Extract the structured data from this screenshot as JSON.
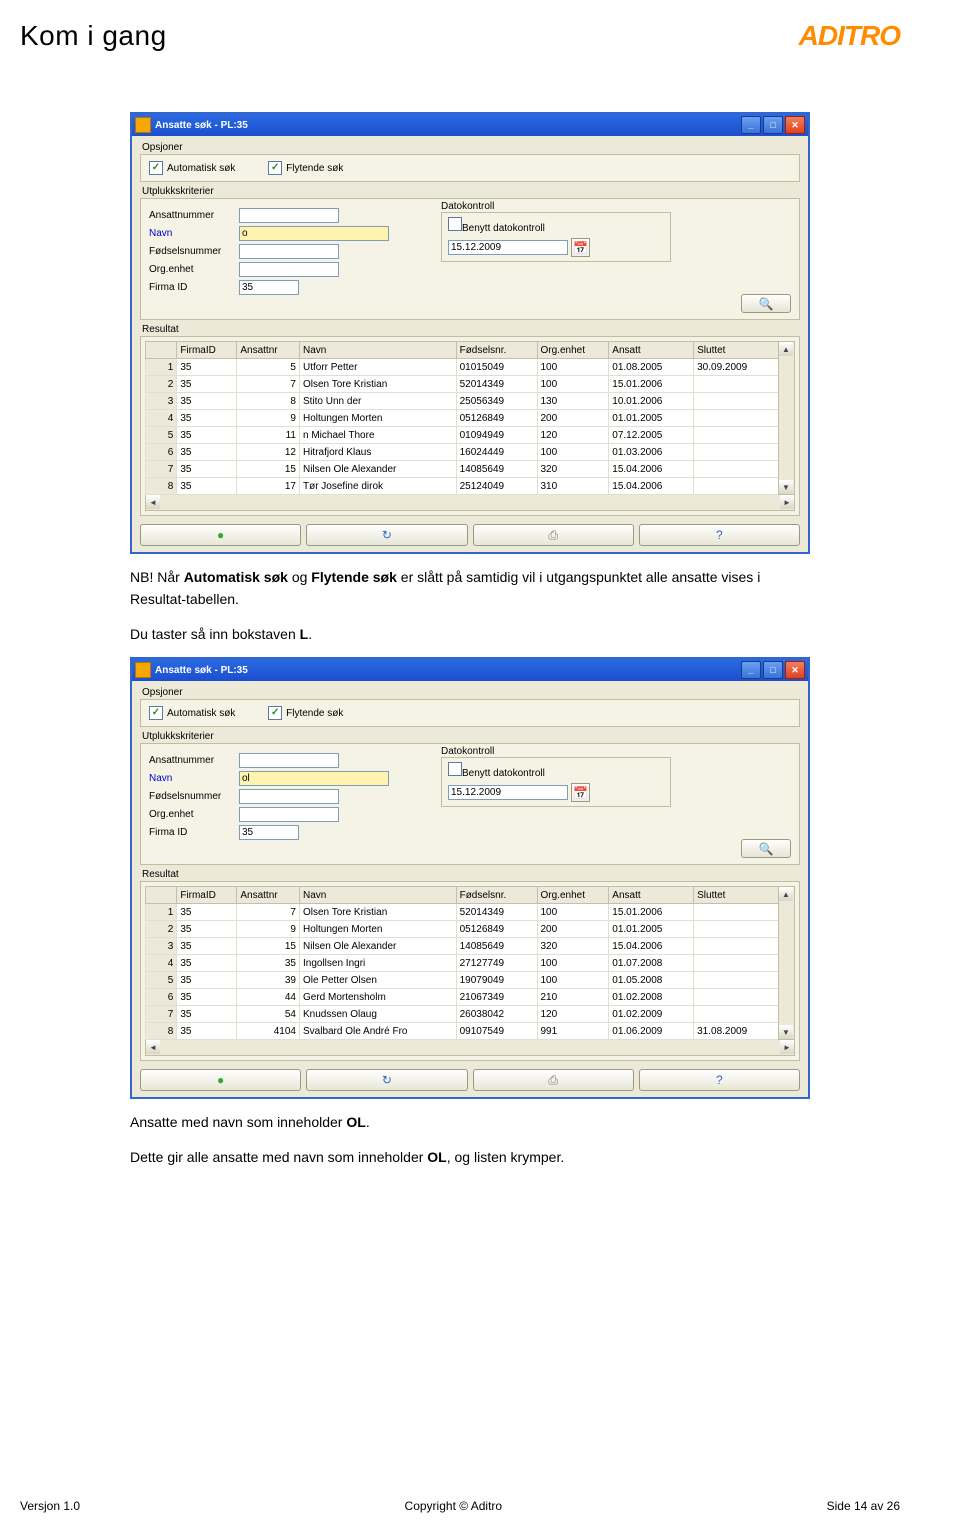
{
  "header": {
    "title": "Kom i gang",
    "logo": "ADITRO"
  },
  "text": {
    "p1_a": "NB! Når ",
    "p1_b": "Automatisk søk",
    "p1_c": " og ",
    "p1_d": "Flytende søk",
    "p1_e": " er slått på samtidig vil i utgangspunktet alle ansatte vises i Resultat-tabellen.",
    "p2_a": "Du taster så inn bokstaven ",
    "p2_b": "L",
    "p2_c": ".",
    "p3_a": "Ansatte med navn som inneholder ",
    "p3_b": "OL",
    "p3_c": ".",
    "p4_a": "Dette gir alle ansatte med navn som inneholder ",
    "p4_b": "OL",
    "p4_c": ", og listen krymper."
  },
  "win": {
    "title": "Ansatte søk - PL:35",
    "opsjoner": "Opsjoner",
    "auto": "Automatisk søk",
    "flyt": "Flytende søk",
    "utplukk": "Utplukkskriterier",
    "ansattnr": "Ansattnummer",
    "navn": "Navn",
    "fnr": "Fødselsnummer",
    "org": "Org.enhet",
    "firma": "Firma ID",
    "firma_val": "35",
    "dato": "Datokontroll",
    "benytt": "Benytt datokontroll",
    "date_val": "15.12.2009",
    "resultat": "Resultat",
    "check": "✓"
  },
  "cols": [
    "FirmaID",
    "Ansattnr",
    "Navn",
    "Fødselsnr.",
    "Org.enhet",
    "Ansatt",
    "Sluttet"
  ],
  "s1": {
    "navn_val": "o",
    "rows": [
      [
        "1",
        "35",
        "5",
        "Utforr Petter",
        "01015049",
        "100",
        "01.08.2005",
        "30.09.2009"
      ],
      [
        "2",
        "35",
        "7",
        "Olsen Tore Kristian",
        "52014349",
        "100",
        "15.01.2006",
        ""
      ],
      [
        "3",
        "35",
        "8",
        "Stito Unn der",
        "25056349",
        "130",
        "10.01.2006",
        ""
      ],
      [
        "4",
        "35",
        "9",
        "Holtungen Morten",
        "05126849",
        "200",
        "01.01.2005",
        ""
      ],
      [
        "5",
        "35",
        "11",
        "n Michael Thore",
        "01094949",
        "120",
        "07.12.2005",
        ""
      ],
      [
        "6",
        "35",
        "12",
        "Hitrafjord Klaus",
        "16024449",
        "100",
        "01.03.2006",
        ""
      ],
      [
        "7",
        "35",
        "15",
        "Nilsen Ole Alexander",
        "14085649",
        "320",
        "15.04.2006",
        ""
      ],
      [
        "8",
        "35",
        "17",
        "Tør Josefine dirok",
        "25124049",
        "310",
        "15.04.2006",
        ""
      ]
    ]
  },
  "s2": {
    "navn_val": "ol",
    "rows": [
      [
        "1",
        "35",
        "7",
        "Olsen Tore Kristian",
        "52014349",
        "100",
        "15.01.2006",
        ""
      ],
      [
        "2",
        "35",
        "9",
        "Holtungen Morten",
        "05126849",
        "200",
        "01.01.2005",
        ""
      ],
      [
        "3",
        "35",
        "15",
        "Nilsen Ole Alexander",
        "14085649",
        "320",
        "15.04.2006",
        ""
      ],
      [
        "4",
        "35",
        "35",
        "Ingollsen Ingri",
        "27127749",
        "100",
        "01.07.2008",
        ""
      ],
      [
        "5",
        "35",
        "39",
        "Ole Petter Olsen",
        "19079049",
        "100",
        "01.05.2008",
        ""
      ],
      [
        "6",
        "35",
        "44",
        "Gerd Mortensholm",
        "21067349",
        "210",
        "01.02.2008",
        ""
      ],
      [
        "7",
        "35",
        "54",
        "Knudssen Olaug",
        "26038042",
        "120",
        "01.02.2009",
        ""
      ],
      [
        "8",
        "35",
        "4104",
        "Svalbard Ole André Fro",
        "09107549",
        "991",
        "01.06.2009",
        "31.08.2009"
      ]
    ]
  },
  "footer": {
    "version": "Versjon 1.0",
    "copyright": "Copyright © Aditro",
    "page": "Side 14 av 26"
  }
}
